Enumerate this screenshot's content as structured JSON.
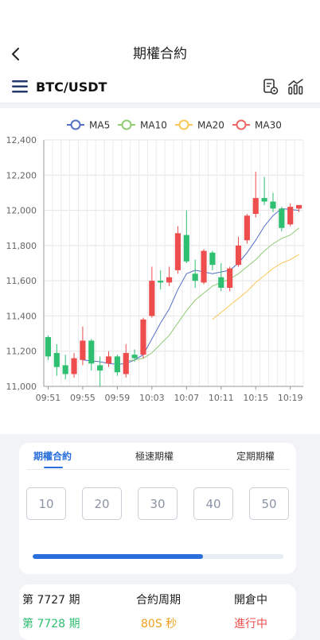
{
  "header": {
    "title": "期權合約",
    "back_icon": "chevron-left-icon"
  },
  "pair_bar": {
    "menu_icon": "hamburger-menu-icon",
    "pair": "BTC/USDT",
    "icons": [
      "document-settings-icon",
      "bar-chart-icon"
    ]
  },
  "chart_data": {
    "type": "candlestick",
    "legend": [
      "MA5",
      "MA10",
      "MA20",
      "MA30"
    ],
    "legend_colors": [
      "#5470c6",
      "#91cc75",
      "#fac858",
      "#ee6666"
    ],
    "up_color": "#ee4d4d",
    "down_color": "#2fbf71",
    "y_tick_labels": [
      "12,400",
      "12,200",
      "12,000",
      "11,800",
      "11,600",
      "11,400",
      "11,200",
      "11,000"
    ],
    "y_tick_values": [
      12400,
      12200,
      12000,
      11800,
      11600,
      11400,
      11200,
      11000
    ],
    "ylim": [
      11000,
      12400
    ],
    "x_tick_labels": [
      "09:51",
      "09:55",
      "09:59",
      "10:03",
      "10:07",
      "10:11",
      "10:15",
      "10:19"
    ],
    "grid": true,
    "candles": [
      {
        "o": 11280,
        "c": 11170,
        "h": 11290,
        "l": 11150
      },
      {
        "o": 11190,
        "c": 11110,
        "h": 11240,
        "l": 11060
      },
      {
        "o": 11120,
        "c": 11070,
        "h": 11180,
        "l": 11040
      },
      {
        "o": 11070,
        "c": 11160,
        "h": 11190,
        "l": 11050
      },
      {
        "o": 11150,
        "c": 11260,
        "h": 11340,
        "l": 11120
      },
      {
        "o": 11260,
        "c": 11130,
        "h": 11270,
        "l": 11090
      },
      {
        "o": 11120,
        "c": 11090,
        "h": 11170,
        "l": 11000
      },
      {
        "o": 11130,
        "c": 11170,
        "h": 11200,
        "l": 11110
      },
      {
        "o": 11170,
        "c": 11080,
        "h": 11180,
        "l": 11060
      },
      {
        "o": 11070,
        "c": 11190,
        "h": 11240,
        "l": 11050
      },
      {
        "o": 11180,
        "c": 11160,
        "h": 11210,
        "l": 11140
      },
      {
        "o": 11180,
        "c": 11380,
        "h": 11390,
        "l": 11160
      },
      {
        "o": 11400,
        "c": 11600,
        "h": 11680,
        "l": 11390
      },
      {
        "o": 11600,
        "c": 11590,
        "h": 11660,
        "l": 11550
      },
      {
        "o": 11590,
        "c": 11620,
        "h": 11680,
        "l": 11570
      },
      {
        "o": 11660,
        "c": 11870,
        "h": 11910,
        "l": 11640
      },
      {
        "o": 11860,
        "c": 11710,
        "h": 12000,
        "l": 11700
      },
      {
        "o": 11640,
        "c": 11600,
        "h": 11720,
        "l": 11560
      },
      {
        "o": 11590,
        "c": 11770,
        "h": 11780,
        "l": 11580
      },
      {
        "o": 11760,
        "c": 11690,
        "h": 11770,
        "l": 11660
      },
      {
        "o": 11620,
        "c": 11560,
        "h": 11700,
        "l": 11540
      },
      {
        "o": 11560,
        "c": 11670,
        "h": 11680,
        "l": 11540
      },
      {
        "o": 11690,
        "c": 11800,
        "h": 11850,
        "l": 11680
      },
      {
        "o": 11830,
        "c": 11970,
        "h": 11980,
        "l": 11810
      },
      {
        "o": 11980,
        "c": 12070,
        "h": 12220,
        "l": 11960
      },
      {
        "o": 12070,
        "c": 12050,
        "h": 12190,
        "l": 12030
      },
      {
        "o": 12050,
        "c": 12010,
        "h": 12100,
        "l": 11990
      },
      {
        "o": 12010,
        "c": 11900,
        "h": 12020,
        "l": 11880
      },
      {
        "o": 11920,
        "c": 12020,
        "h": 12040,
        "l": 11910
      },
      {
        "o": 12010,
        "c": 12030,
        "h": 12030,
        "l": 11990
      }
    ],
    "ma5": [
      null,
      null,
      null,
      null,
      11150,
      11145,
      11140,
      11130,
      11125,
      11130,
      11150,
      11180,
      11270,
      11360,
      11440,
      11550,
      11640,
      11660,
      11650,
      11640,
      11650,
      11660,
      11700,
      11760,
      11830,
      11910,
      11970,
      12010,
      12005,
      12000
    ],
    "ma10": [
      null,
      null,
      null,
      null,
      null,
      null,
      null,
      null,
      null,
      11145,
      11150,
      11160,
      11190,
      11240,
      11290,
      11360,
      11430,
      11490,
      11530,
      11570,
      11590,
      11610,
      11640,
      11680,
      11720,
      11770,
      11810,
      11840,
      11860,
      11900
    ],
    "ma20": [
      null,
      null,
      null,
      null,
      null,
      null,
      null,
      null,
      null,
      null,
      null,
      null,
      null,
      null,
      null,
      null,
      null,
      null,
      null,
      11380,
      11420,
      11460,
      11500,
      11540,
      11590,
      11630,
      11670,
      11700,
      11720,
      11750
    ],
    "ma30": []
  },
  "tabs": [
    {
      "label": "期權合約",
      "active": true
    },
    {
      "label": "極速期權",
      "active": false
    },
    {
      "label": "定期期權",
      "active": false
    }
  ],
  "durations": [
    "10",
    "20",
    "30",
    "40",
    "50"
  ],
  "progress": 0.68,
  "periods": {
    "current_period": "第 7727 期",
    "cycle_label": "合約周期",
    "status_label": "開倉中",
    "next_period": "第 7728 期",
    "cycle_value": "80S 秒",
    "next_status": "進行中",
    "colors": {
      "next": "#2fbf71",
      "cycle": "#f0a020",
      "status": "#ee4d4d"
    }
  }
}
